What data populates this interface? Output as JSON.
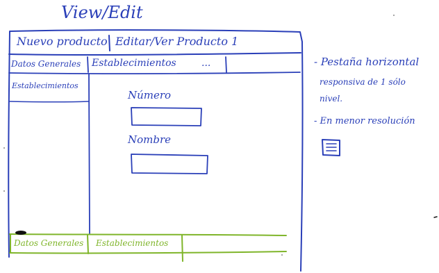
{
  "title": "View/Edit",
  "header_tabs": {
    "new_products": "Nuevo producto",
    "edit_view": "Editar/Ver Producto 1"
  },
  "subtabs": {
    "general_data": "Datos Generales",
    "establishments": "Establecimientos",
    "more": "...",
    "sidebar_item": "Establecimientos"
  },
  "form": {
    "number_label": "Número",
    "name_label": "Nombre"
  },
  "bottom_tabs": {
    "general_data": "Datos Generales",
    "establishments": "Establecimientos"
  },
  "notes": {
    "line1": "- Pestaña horizontal",
    "line2": "responsiva de 1 sólo",
    "line3": "nivel.",
    "line4": "- En menor resolución"
  },
  "colors": {
    "ink_blue": "#2a3fb8",
    "ink_green": "#7fb52a",
    "ink_black": "#111111"
  },
  "icons": {
    "menu": "hamburger-menu-icon"
  }
}
